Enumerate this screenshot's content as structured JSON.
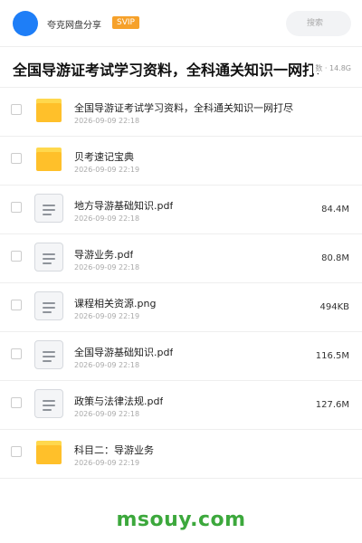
{
  "header": {
    "share_name": "夸克网盘分享",
    "badge": "SVIP",
    "search_placeholder": "搜索",
    "accent": "#1e7ef7"
  },
  "title": {
    "text": "全国导游证考试学习资料，全科通关知识一网打尽",
    "meta": "数 · 14.8G"
  },
  "files": [
    {
      "name": "全国导游证考试学习资料，全科通关知识一网打尽",
      "date": "2026-09-09 22:18",
      "size": "",
      "icon": "folder-icon"
    },
    {
      "name": "贝考速记宝典",
      "date": "2026-09-09 22:19",
      "size": "",
      "icon": "folder-icon"
    },
    {
      "name": "地方导游基础知识.pdf",
      "date": "2026-09-09 22:18",
      "size": "84.4M",
      "icon": "document-icon"
    },
    {
      "name": "导游业务.pdf",
      "date": "2026-09-09 22:18",
      "size": "80.8M",
      "icon": "document-icon"
    },
    {
      "name": "课程相关资源.png",
      "date": "2026-09-09 22:19",
      "size": "494KB",
      "icon": "document-icon"
    },
    {
      "name": "全国导游基础知识.pdf",
      "date": "2026-09-09 22:18",
      "size": "116.5M",
      "icon": "document-icon"
    },
    {
      "name": "政策与法律法规.pdf",
      "date": "2026-09-09 22:18",
      "size": "127.6M",
      "icon": "document-icon"
    },
    {
      "name": "科目二：导游业务",
      "date": "2026-09-09 22:19",
      "size": "",
      "icon": "folder-icon"
    }
  ],
  "footer": {
    "watermark": "msouy.com",
    "watermark_color": "#3ca83c"
  }
}
